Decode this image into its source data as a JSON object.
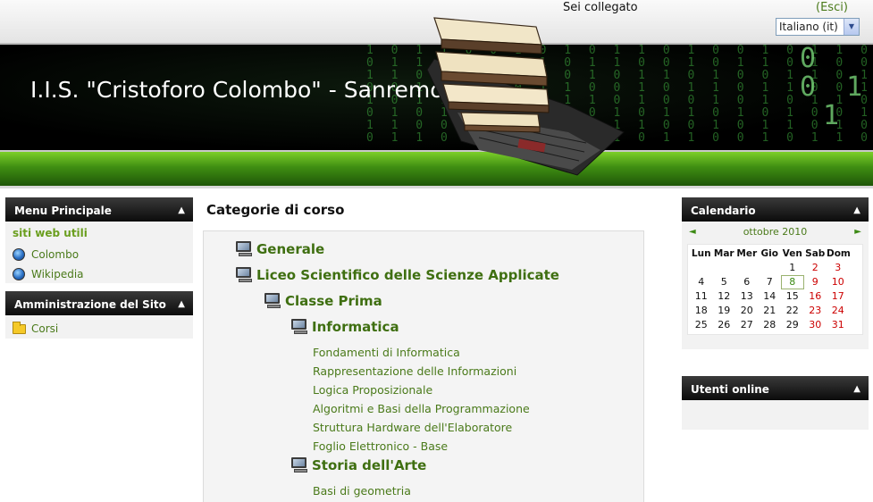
{
  "header": {
    "login_text": "Sei collegato",
    "logout_link": "Esci",
    "language_select": "Italiano (it)",
    "site_title": "I.I.S. \"Cristoforo Colombo\" - Sanremo"
  },
  "left_blocks": {
    "main_menu": {
      "title": "Menu Principale",
      "subheading": "siti web utili",
      "links": [
        {
          "label": "Colombo",
          "icon": "globe-icon"
        },
        {
          "label": "Wikipedia",
          "icon": "globe-icon"
        }
      ]
    },
    "site_admin": {
      "title": "Amministrazione del Sito",
      "links": [
        {
          "label": "Corsi",
          "icon": "folder-icon"
        }
      ]
    }
  },
  "main": {
    "title": "Categorie di corso",
    "categories": [
      {
        "label": "Generale"
      },
      {
        "label": "Liceo Scientifico delle Scienze Applicate"
      },
      {
        "label": "Classe Prima"
      },
      {
        "label": "Informatica"
      },
      {
        "label": "Storia dell'Arte"
      }
    ],
    "informatica_courses": [
      "Fondamenti di Informatica",
      "Rappresentazione delle Informazioni",
      "Logica Proposizionale",
      "Algoritmi e Basi della Programmazione",
      "Struttura Hardware dell'Elaboratore",
      "Foglio Elettronico - Base"
    ],
    "storia_courses": [
      "Basi di geometria"
    ]
  },
  "right_blocks": {
    "calendar": {
      "title": "Calendario",
      "month": "ottobre 2010",
      "prev": "◄",
      "next": "►",
      "day_headers": [
        "Lun",
        "Mar",
        "Mer",
        "Gio",
        "Ven",
        "Sab",
        "Dom"
      ],
      "weeks": [
        [
          "",
          "",
          "",
          "",
          "1",
          "2",
          "3"
        ],
        [
          "4",
          "5",
          "6",
          "7",
          "8",
          "9",
          "10"
        ],
        [
          "11",
          "12",
          "13",
          "14",
          "15",
          "16",
          "17"
        ],
        [
          "18",
          "19",
          "20",
          "21",
          "22",
          "23",
          "24"
        ],
        [
          "25",
          "26",
          "27",
          "28",
          "29",
          "30",
          "31"
        ]
      ],
      "today": "8"
    },
    "online_users": {
      "title": "Utenti online"
    }
  },
  "colors": {
    "accent_green": "#4a7a1a",
    "heading_green": "#3f6f11",
    "weekend_red": "#cc0000",
    "banner_bar_green": "#3f8e12"
  }
}
